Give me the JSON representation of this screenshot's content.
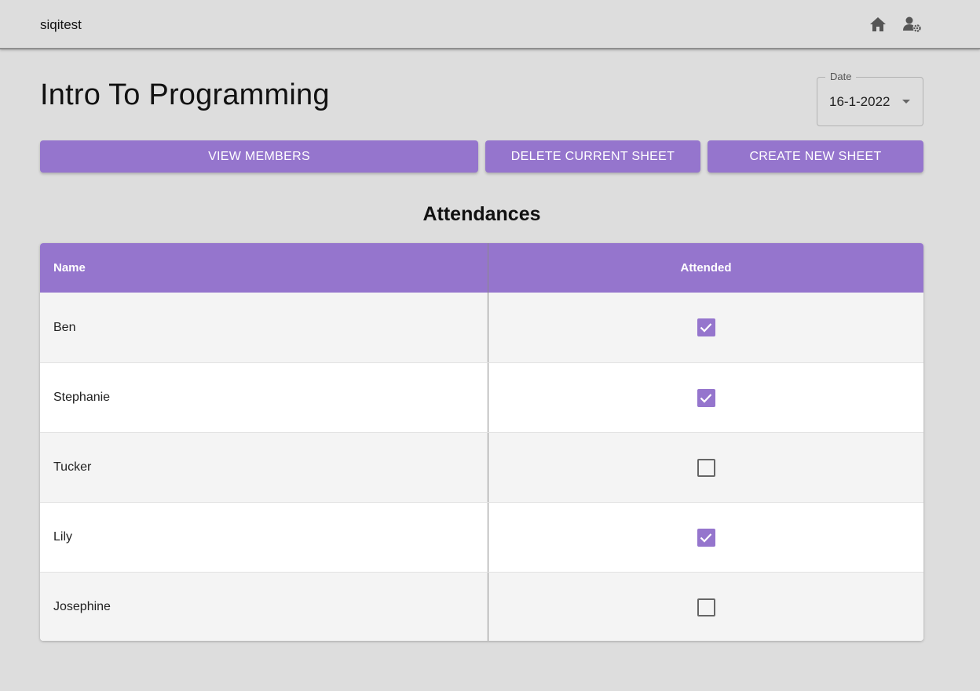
{
  "appbar": {
    "brand": "siqitest",
    "icons": [
      "home-icon",
      "user-settings-icon"
    ]
  },
  "page": {
    "title": "Intro To Programming"
  },
  "date_select": {
    "label": "Date",
    "value": "16-1-2022"
  },
  "actions": {
    "view_members": "VIEW MEMBERS",
    "delete_sheet": "DELETE CURRENT SHEET",
    "create_sheet": "CREATE NEW SHEET"
  },
  "attendance": {
    "title": "Attendances",
    "columns": [
      "Name",
      "Attended"
    ],
    "rows": [
      {
        "name": "Ben",
        "attended": true
      },
      {
        "name": "Stephanie",
        "attended": true
      },
      {
        "name": "Tucker",
        "attended": false
      },
      {
        "name": "Lily",
        "attended": true
      },
      {
        "name": "Josephine",
        "attended": false
      }
    ]
  },
  "colors": {
    "accent": "#9575cd",
    "background": "#dddddd",
    "row_alt": "#f4f4f4"
  }
}
